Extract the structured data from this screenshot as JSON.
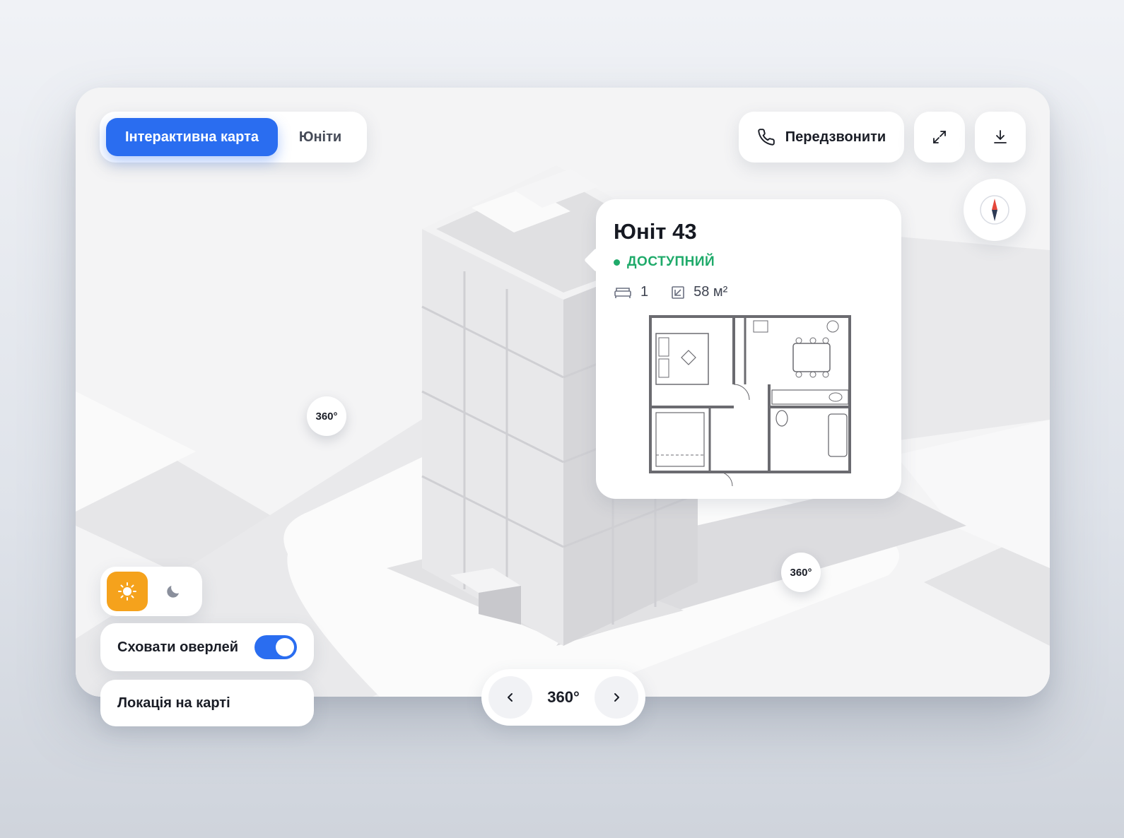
{
  "tabs": {
    "active": "Інтерактивна карта",
    "units": "Юніти"
  },
  "toolbar": {
    "callback_label": "Передзвонити",
    "fullscreen_icon": "expand-icon",
    "download_icon": "download-icon",
    "compass_icon": "compass-icon"
  },
  "popup": {
    "title": "Юніт 43",
    "status": "ДОСТУПНИЙ",
    "bedrooms": "1",
    "area": "58 м²",
    "status_color": "#1faa6a"
  },
  "markers": {
    "left": "360°",
    "right": "360°"
  },
  "controls": {
    "overlay_label": "Сховати оверлей",
    "overlay_on": true,
    "location_label": "Локація на карті",
    "rotation_label": "360°"
  },
  "colors": {
    "accent": "#2a6df0",
    "sun": "#f5a21c"
  }
}
